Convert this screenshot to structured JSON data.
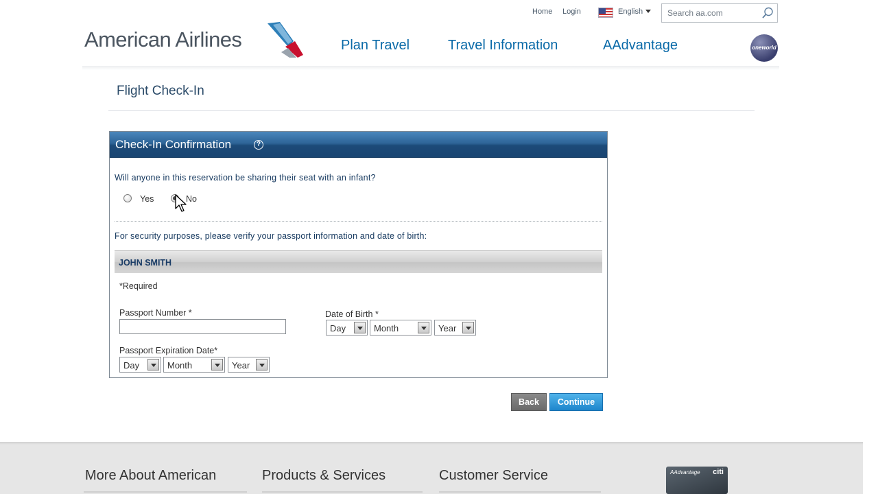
{
  "header": {
    "utility_links": [
      "Home",
      "Login"
    ],
    "language": "English",
    "search_placeholder": "Search aa.com",
    "logo_text": "American Airlines",
    "nav": [
      "Plan Travel",
      "Travel Information",
      "AAdvantage"
    ],
    "alliance_logo": "oneworld"
  },
  "page": {
    "title": "Flight Check-In"
  },
  "panel": {
    "title": "Check-In Confirmation",
    "help_icon": "?",
    "infant_question": "Will anyone in this reservation be sharing their seat with an infant?",
    "infant_options": [
      {
        "label": "Yes",
        "selected": false
      },
      {
        "label": "No",
        "selected": true
      }
    ],
    "security_prompt": "For security purposes, please verify your passport information and date of birth:",
    "passenger_name": "JOHN SMITH",
    "required_note": "*Required",
    "passport_number_label": "Passport Number *",
    "passport_number_value": "",
    "dob_label": "Date of Birth *",
    "dob": {
      "day": "Day",
      "month": "Month",
      "year": "Year"
    },
    "expiration_label": "Passport Expiration Date*",
    "expiration": {
      "day": "Day",
      "month": "Month",
      "year": "Year"
    }
  },
  "actions": {
    "back": "Back",
    "continue": "Continue"
  },
  "footer": {
    "columns": [
      "More About American",
      "Products & Services",
      "Customer Service"
    ],
    "card_brand": "AAdvantage",
    "card_bank": "citi"
  },
  "colors": {
    "nav_link": "#0a6aa8",
    "panel_header": "#1c4a78",
    "continue_button": "#1e86cc",
    "back_button": "#6a6a6a"
  }
}
